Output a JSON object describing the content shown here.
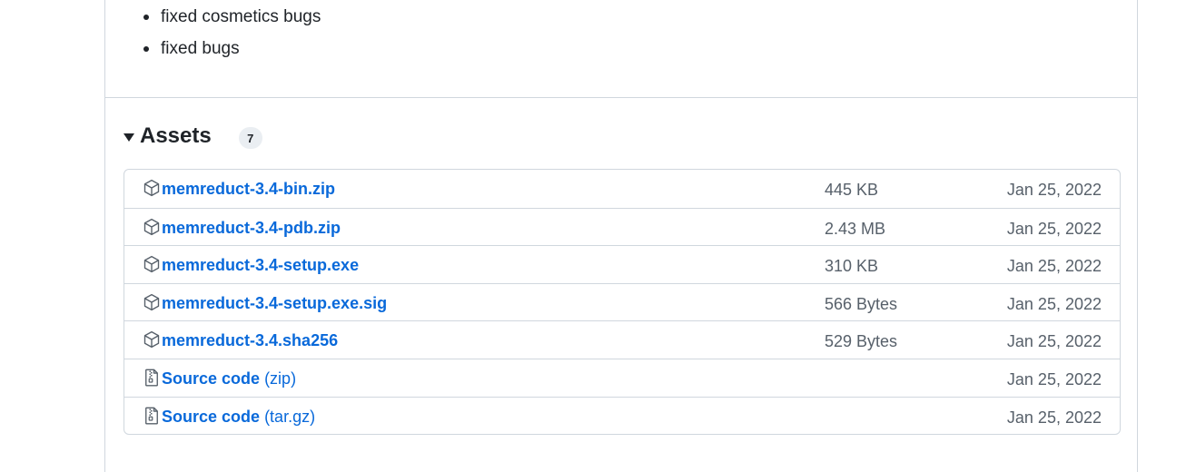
{
  "release_notes": {
    "items": [
      "fixed cosmetics bugs",
      "fixed bugs"
    ]
  },
  "assets": {
    "title": "Assets",
    "count": "7",
    "rows": [
      {
        "name": "memreduct-3.4-bin.zip",
        "suffix": "",
        "size": "445 KB",
        "date": "Jan 25, 2022",
        "icon": "package-icon"
      },
      {
        "name": "memreduct-3.4-pdb.zip",
        "suffix": "",
        "size": "2.43 MB",
        "date": "Jan 25, 2022",
        "icon": "package-icon"
      },
      {
        "name": "memreduct-3.4-setup.exe",
        "suffix": "",
        "size": "310 KB",
        "date": "Jan 25, 2022",
        "icon": "package-icon"
      },
      {
        "name": "memreduct-3.4-setup.exe.sig",
        "suffix": "",
        "size": "566 Bytes",
        "date": "Jan 25, 2022",
        "icon": "package-icon"
      },
      {
        "name": "memreduct-3.4.sha256",
        "suffix": "",
        "size": "529 Bytes",
        "date": "Jan 25, 2022",
        "icon": "package-icon"
      },
      {
        "name": "Source code",
        "suffix": "(zip)",
        "size": "",
        "date": "Jan 25, 2022",
        "icon": "file-zip-icon"
      },
      {
        "name": "Source code",
        "suffix": "(tar.gz)",
        "size": "",
        "date": "Jan 25, 2022",
        "icon": "file-zip-icon"
      }
    ]
  },
  "colors": {
    "link": "#0969da",
    "muted": "#57606a",
    "border": "#d0d7de",
    "text": "#1f2328"
  }
}
